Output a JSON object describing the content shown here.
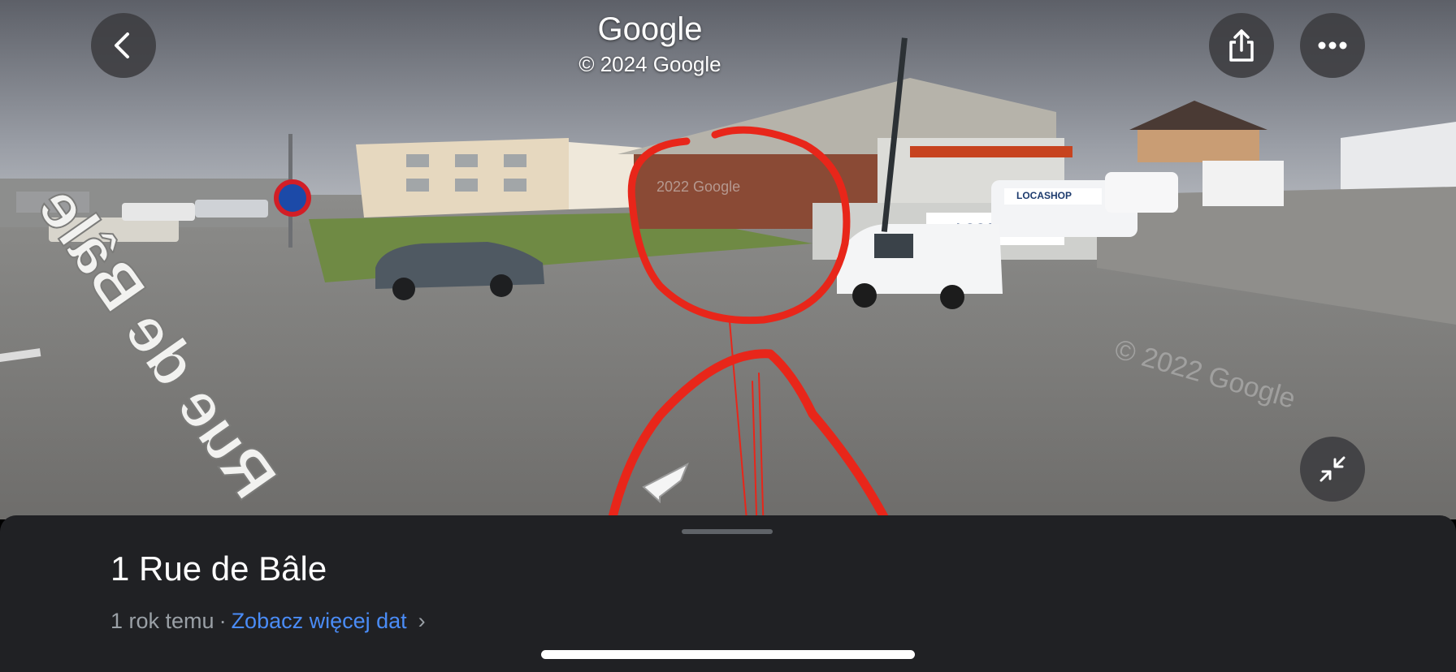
{
  "header": {
    "title": "Google",
    "copyright": "© 2024 Google"
  },
  "buttons": {
    "back_icon": "chevron-left",
    "share_icon": "share",
    "more_icon": "more-horizontal",
    "collapse_icon": "collapse-arrows"
  },
  "scene": {
    "street_label": "Rue de Bâle",
    "shop_sign": "LOCASHOP",
    "van_sign": "LOCASHOP",
    "watermark_center": "2022 Google",
    "watermark_right": "© 2022 Google"
  },
  "sheet": {
    "address": "1 Rue de Bâle",
    "age": "1 rok temu",
    "separator": "·",
    "see_more": "Zobacz więcej dat",
    "chevron": "›"
  },
  "colors": {
    "annotation": "#e8261a",
    "link": "#4a8cf7",
    "sheet_bg": "#202124"
  }
}
